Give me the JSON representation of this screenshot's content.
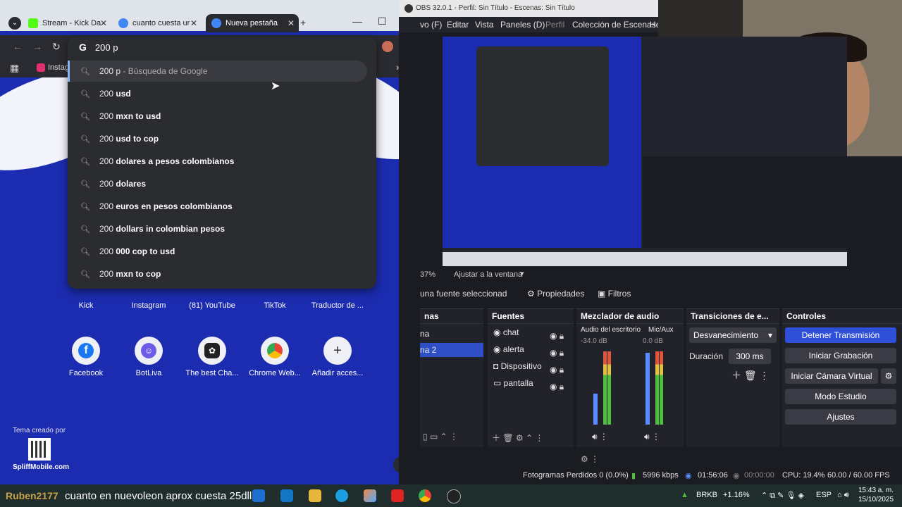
{
  "chrome": {
    "tabs": [
      {
        "label": "Stream - Kick Da",
        "color": "#53fc18"
      },
      {
        "label": "cuanto cuesta ur",
        "color": "#4285f4"
      },
      {
        "label": "Nueva pestaña",
        "color": "#4285f4"
      }
    ],
    "omnibox_text": "200 p",
    "bookmark_label": "Instag",
    "suggestions": [
      {
        "prefix": "200 p",
        "rest": " - Búsqueda de Google"
      },
      {
        "prefix": "200 ",
        "rest": "usd"
      },
      {
        "prefix": "200 ",
        "rest": "mxn to usd"
      },
      {
        "prefix": "200 ",
        "rest": "usd to cop"
      },
      {
        "prefix": "200 ",
        "rest": "dolares a pesos colombianos"
      },
      {
        "prefix": "200 ",
        "rest": "dolares"
      },
      {
        "prefix": "200 ",
        "rest": "euros en pesos colombianos"
      },
      {
        "prefix": "200 ",
        "rest": "dollars in colombian pesos"
      },
      {
        "prefix": "200 ",
        "rest": "000 cop to usd"
      },
      {
        "prefix": "200 ",
        "rest": "mxn to cop"
      }
    ],
    "shortcuts_row1": [
      "Kick",
      "Instagram",
      "(81) YouTube",
      "TikTok",
      "Traductor de ..."
    ],
    "shortcuts_row2": [
      "Facebook",
      "BotLiva",
      "The best Cha...",
      "Chrome Web...",
      "Añadir acces..."
    ],
    "theme_credit": "Tema creado por",
    "theme_site": "SpliffMobile.com"
  },
  "obs": {
    "title": "OBS 32.0.1 - Perfil: Sin Título - Escenas: Sin Título",
    "menu": [
      "vo (F)",
      "Editar",
      "Vista",
      "Paneles (D)",
      "Perfil",
      "Colección de Escenas",
      "He"
    ],
    "zoom": "37%",
    "fit_label": "Ajustar a la ventana",
    "no_source": "una fuente seleccionad",
    "properties": "Propiedades",
    "filters": "Filtros",
    "scenes_header": "nas",
    "scenes": [
      "na",
      "na 2"
    ],
    "sources_header": "Fuentes",
    "sources": [
      "chat",
      "alerta",
      "Dispositivo",
      "pantalla"
    ],
    "mixer_header": "Mezclador de audio",
    "mixer_ch1": "Audio del escritorio",
    "mixer_ch1_db": "-34.0 dB",
    "mixer_ch2": "Mic/Aux",
    "mixer_ch2_db": "0.0 dB",
    "transitions_header": "Transiciones de e...",
    "transition": "Desvanecimiento",
    "duration_label": "Duración",
    "duration_value": "300 ms",
    "controls_header": "Controles",
    "controls": [
      "Detener Transmisión",
      "Iniciar Grabación",
      "Iniciar Cámara Virtual",
      "Modo Estudio",
      "Ajustes"
    ],
    "status": {
      "dropped": "Fotogramas Perdidos 0 (0.0%)",
      "bitrate": "5996 kbps",
      "live_time": "01:56:06",
      "rec_time": "00:00:00",
      "cpu": "CPU: 19.4%",
      "fps": "60.00 / 60.00 FPS"
    },
    "meter_scale": [
      "0",
      "-5",
      "-10",
      "-15",
      "-20",
      "-25",
      "-30",
      "-35",
      "-40",
      "-45",
      "-50",
      "-55",
      "-60"
    ]
  },
  "taskbar": {
    "overlay_user": "Ruben2177",
    "overlay_msg": "cuanto en nuevoleon aprox cuesta 25dlls",
    "ticker": "BRKB",
    "ticker_change": "+1.16%",
    "lang": "ESP",
    "time": "15:43 a. m.",
    "date": "15/10/2025"
  }
}
